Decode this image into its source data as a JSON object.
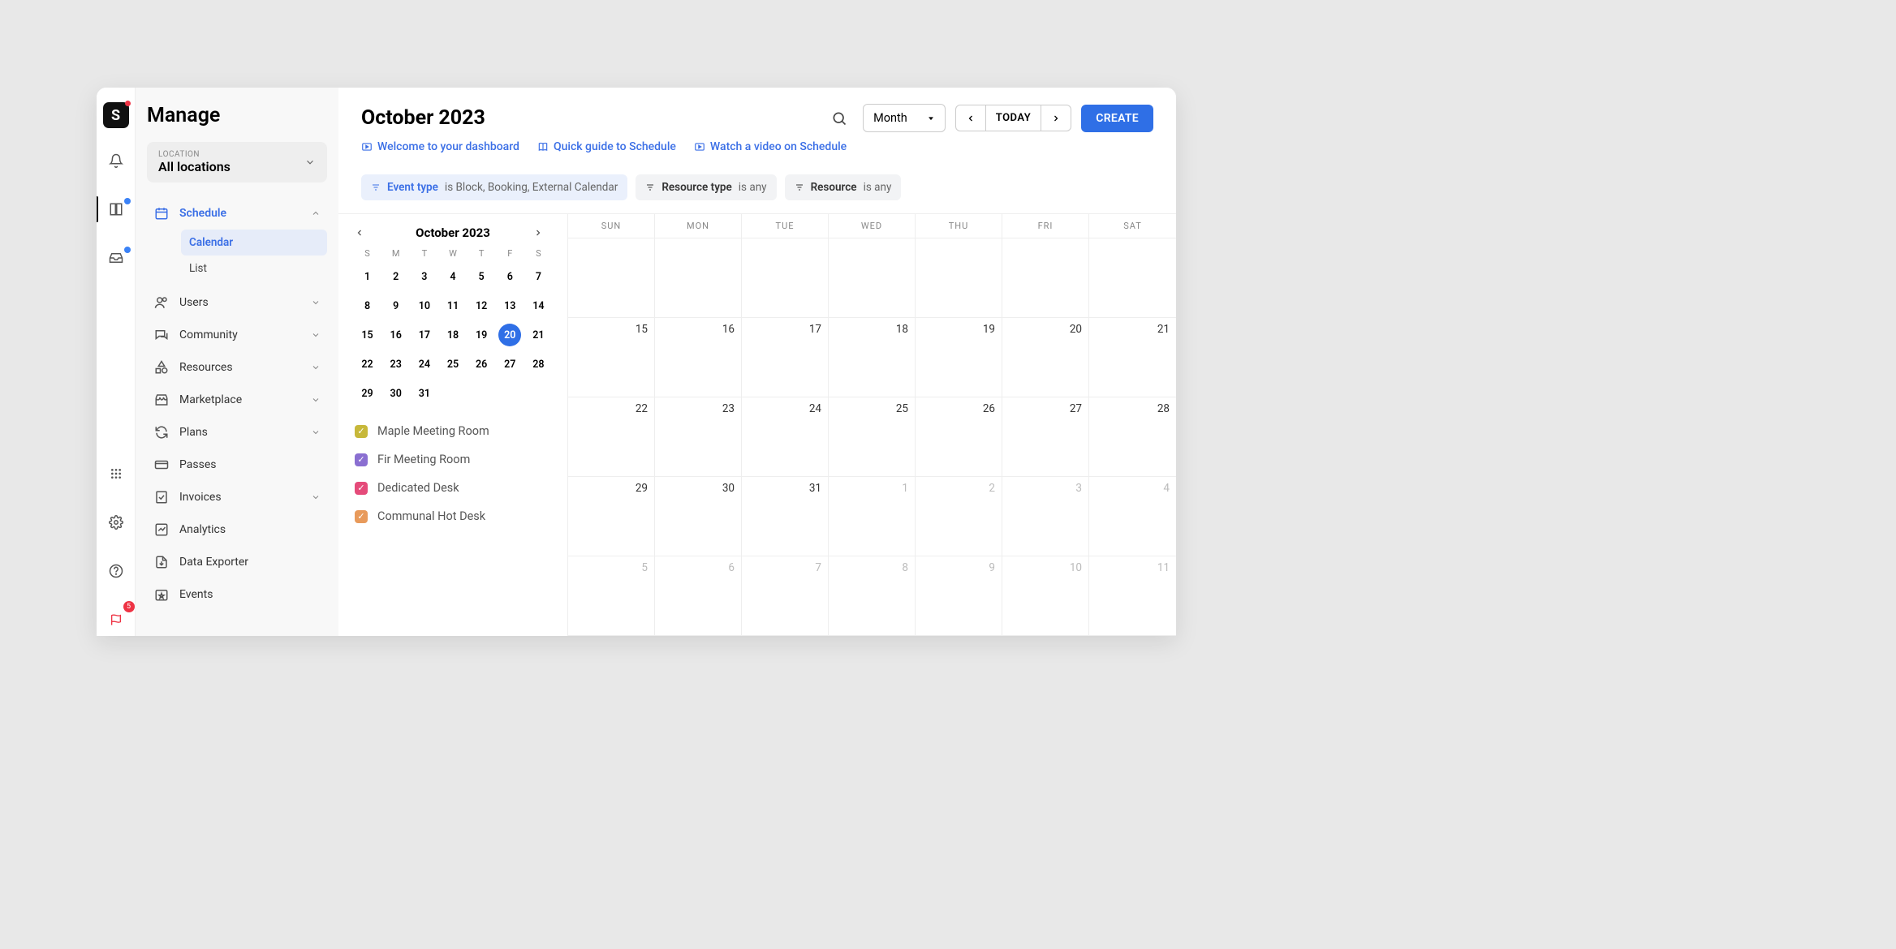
{
  "app": {
    "title": "Manage",
    "badge_count": "5"
  },
  "location": {
    "label": "LOCATION",
    "value": "All locations"
  },
  "nav": {
    "schedule": "Schedule",
    "schedule_sub": {
      "calendar": "Calendar",
      "list": "List"
    },
    "users": "Users",
    "community": "Community",
    "resources": "Resources",
    "marketplace": "Marketplace",
    "plans": "Plans",
    "passes": "Passes",
    "invoices": "Invoices",
    "analytics": "Analytics",
    "data_exporter": "Data Exporter",
    "events": "Events"
  },
  "header": {
    "title": "October 2023",
    "view": "Month",
    "today": "TODAY",
    "create": "CREATE",
    "help_links": [
      "Welcome to your dashboard",
      "Quick guide to Schedule",
      "Watch a video on Schedule"
    ]
  },
  "filters": [
    {
      "name": "Event type",
      "verb": "is",
      "value": "Block, Booking, External Calendar",
      "blue": true
    },
    {
      "name": "Resource type",
      "verb": "is",
      "value": "any",
      "blue": false
    },
    {
      "name": "Resource",
      "verb": "is",
      "value": "any",
      "blue": false
    }
  ],
  "mini": {
    "title": "October 2023",
    "dow": [
      "S",
      "M",
      "T",
      "W",
      "T",
      "F",
      "S"
    ],
    "days": [
      "1",
      "2",
      "3",
      "4",
      "5",
      "6",
      "7",
      "8",
      "9",
      "10",
      "11",
      "12",
      "13",
      "14",
      "15",
      "16",
      "17",
      "18",
      "19",
      "20",
      "21",
      "22",
      "23",
      "24",
      "25",
      "26",
      "27",
      "28",
      "29",
      "30",
      "31"
    ],
    "selected": "20"
  },
  "resources": [
    {
      "label": "Maple Meeting Room",
      "color": "#c7b83a"
    },
    {
      "label": "Fir Meeting Room",
      "color": "#8a6fd1"
    },
    {
      "label": "Dedicated Desk",
      "color": "#e54b7a"
    },
    {
      "label": "Communal Hot Desk",
      "color": "#e89a5b"
    }
  ],
  "bigcal": {
    "dow": [
      "SUN",
      "MON",
      "TUE",
      "WED",
      "THU",
      "FRI",
      "SAT"
    ],
    "rows": [
      [
        "",
        "",
        "",
        "",
        "",
        "",
        ""
      ],
      [
        "15",
        "16",
        "17",
        "18",
        "19",
        "20",
        "21"
      ],
      [
        "22",
        "23",
        "24",
        "25",
        "26",
        "27",
        "28"
      ],
      [
        "29",
        "30",
        "31",
        "1",
        "2",
        "3",
        "4"
      ],
      [
        "5",
        "6",
        "7",
        "8",
        "9",
        "10",
        "11"
      ]
    ],
    "other_month_from_row": 3,
    "other_month_from_col": 3
  }
}
